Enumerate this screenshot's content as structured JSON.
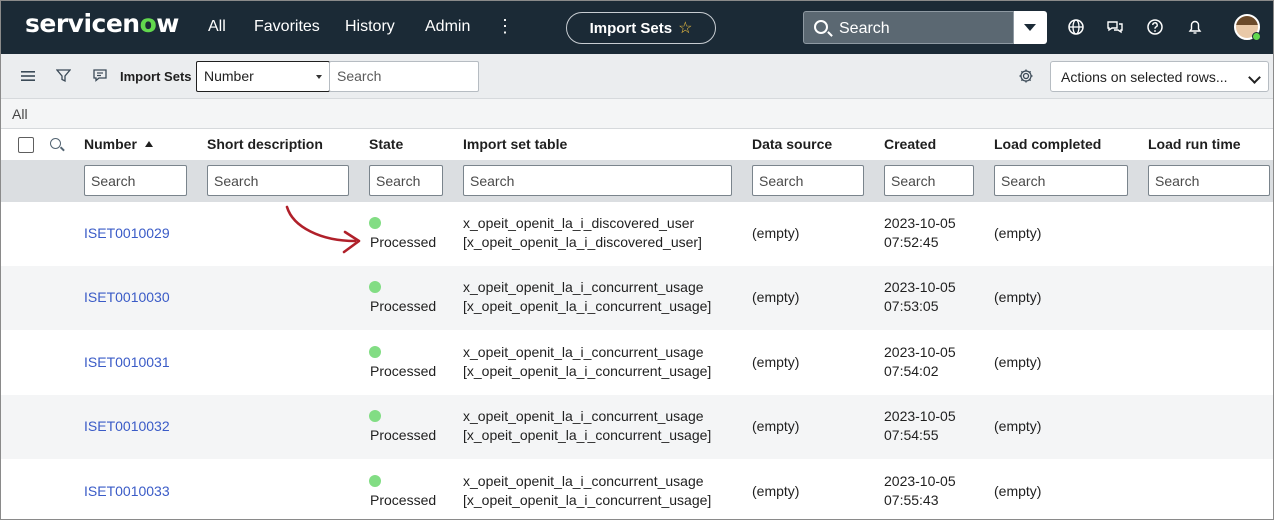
{
  "nav": {
    "logo_prefix": "servicen",
    "logo_o": "o",
    "logo_suffix": "w",
    "links": [
      "All",
      "Favorites",
      "History",
      "Admin"
    ],
    "more": "⋮",
    "pill_label": "Import Sets",
    "pill_star": "☆",
    "search_label": "Search"
  },
  "toolbar": {
    "title": "Import Sets",
    "field_select": "Number",
    "search_placeholder": "Search",
    "actions_label": "Actions on selected rows..."
  },
  "breadcrumb": "All",
  "columns": [
    "Number",
    "Short description",
    "State",
    "Import set table",
    "Data source",
    "Created",
    "Load completed",
    "Load run time"
  ],
  "filter_placeholder": "Search",
  "rows": [
    {
      "number": "ISET0010029",
      "state": "Processed",
      "table1": "x_opeit_openit_la_i_discovered_user",
      "table2": "[x_opeit_openit_la_i_discovered_user]",
      "data_source": "(empty)",
      "created_date": "2023-10-05",
      "created_time": "07:52:45",
      "load_completed": "(empty)"
    },
    {
      "number": "ISET0010030",
      "state": "Processed",
      "table1": "x_opeit_openit_la_i_concurrent_usage",
      "table2": "[x_opeit_openit_la_i_concurrent_usage]",
      "data_source": "(empty)",
      "created_date": "2023-10-05",
      "created_time": "07:53:05",
      "load_completed": "(empty)"
    },
    {
      "number": "ISET0010031",
      "state": "Processed",
      "table1": "x_opeit_openit_la_i_concurrent_usage",
      "table2": "[x_opeit_openit_la_i_concurrent_usage]",
      "data_source": "(empty)",
      "created_date": "2023-10-05",
      "created_time": "07:54:02",
      "load_completed": "(empty)"
    },
    {
      "number": "ISET0010032",
      "state": "Processed",
      "table1": "x_opeit_openit_la_i_concurrent_usage",
      "table2": "[x_opeit_openit_la_i_concurrent_usage]",
      "data_source": "(empty)",
      "created_date": "2023-10-05",
      "created_time": "07:54:55",
      "load_completed": "(empty)"
    },
    {
      "number": "ISET0010033",
      "state": "Processed",
      "table1": "x_opeit_openit_la_i_concurrent_usage",
      "table2": "[x_opeit_openit_la_i_concurrent_usage]",
      "data_source": "(empty)",
      "created_date": "2023-10-05",
      "created_time": "07:55:43",
      "load_completed": "(empty)"
    }
  ],
  "colors": {
    "nav_bg": "#1b2a36",
    "link": "#3a5bc7",
    "state_processed": "#82dd84",
    "annotation_arrow": "#b0202a"
  },
  "icons": [
    "list-icon",
    "filter-icon",
    "context-menu-icon",
    "globe-icon",
    "chat-icon",
    "help-icon",
    "bell-icon",
    "gear-icon",
    "search-icon",
    "star-icon"
  ]
}
